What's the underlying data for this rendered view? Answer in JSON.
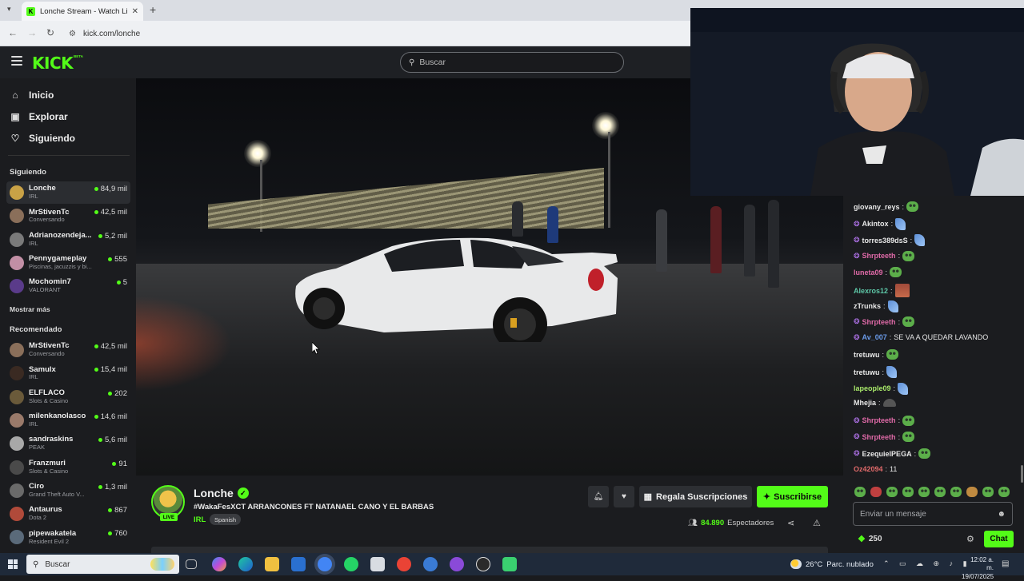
{
  "browser": {
    "tab_title": "Lonche Stream - Watch Live",
    "url": "kick.com/lonche"
  },
  "kick": {
    "logo": "KICK",
    "logo_badge": "BETA",
    "search_placeholder": "Buscar"
  },
  "sidebar": {
    "nav": [
      {
        "label": "Inicio",
        "icon": "home-icon"
      },
      {
        "label": "Explorar",
        "icon": "compass-icon"
      },
      {
        "label": "Siguiendo",
        "icon": "heart-icon"
      }
    ],
    "following_header": "Siguiendo",
    "following": [
      {
        "name": "Lonche",
        "category": "IRL",
        "viewers": "84,9 mil",
        "active": true,
        "avatar_color": "#c9a246"
      },
      {
        "name": "MrStivenTc",
        "category": "Conversando",
        "viewers": "42,5 mil",
        "avatar_color": "#8a6f5a"
      },
      {
        "name": "Adrianozendeja...",
        "category": "IRL",
        "viewers": "5,2 mil",
        "avatar_color": "#7a7a7a"
      },
      {
        "name": "Pennygameplay",
        "category": "Piscinas, jacuzzis y bi...",
        "viewers": "555",
        "avatar_color": "#c28fa5"
      },
      {
        "name": "Mochomin7",
        "category": "VALORANT",
        "viewers": "5",
        "avatar_color": "#5a3b8a"
      }
    ],
    "show_more": "Mostrar más",
    "recommended_header": "Recomendado",
    "recommended": [
      {
        "name": "MrStivenTc",
        "category": "Conversando",
        "viewers": "42,5 mil",
        "avatar_color": "#8a6f5a"
      },
      {
        "name": "Samulx",
        "category": "IRL",
        "viewers": "15,4 mil",
        "avatar_color": "#3a2a22"
      },
      {
        "name": "ELFLACO",
        "category": "Slots & Casino",
        "viewers": "202",
        "avatar_color": "#6a5a3a"
      },
      {
        "name": "milenkanolasco",
        "category": "IRL",
        "viewers": "14,6 mil",
        "avatar_color": "#9a7a6a"
      },
      {
        "name": "sandraskins",
        "category": "PEAK",
        "viewers": "5,6 mil",
        "avatar_color": "#a8a8a8"
      },
      {
        "name": "Franzmuri",
        "category": "Slots & Casino",
        "viewers": "91",
        "avatar_color": "#4a4a4a"
      },
      {
        "name": "Ciro",
        "category": "Grand Theft Auto V...",
        "viewers": "1,3 mil",
        "avatar_color": "#6a6a6a"
      },
      {
        "name": "Antaurus",
        "category": "Dota 2",
        "viewers": "867",
        "avatar_color": "#b04a3a"
      },
      {
        "name": "pipewakatela",
        "category": "Resident Evil 2",
        "viewers": "760",
        "avatar_color": "#5a6a7a"
      }
    ]
  },
  "stream": {
    "streamer": "Lonche",
    "live_badge": "LIVE",
    "title": "#WakaFesXCT ARRANCONES FT NATANAEL CANO Y EL BARBAS",
    "category": "IRL",
    "language": "Spanish",
    "gift_label": "Regala Suscripciones",
    "subscribe_label": "Suscribirse",
    "viewers_count": "84.890",
    "viewers_label": "Espectadores"
  },
  "chat": {
    "messages": [
      {
        "user": "giovany_reys",
        "color": "#e8e8e8",
        "badge": false,
        "emote": "frog"
      },
      {
        "user": "Akintox",
        "color": "#e8e8e8",
        "badge": true,
        "emote": "fish"
      },
      {
        "user": "torres389dsS",
        "color": "#e8e8e8",
        "badge": true,
        "emote": "fish"
      },
      {
        "user": "Shrpteeth",
        "color": "#e06aa8",
        "badge": true,
        "emote": "frog"
      },
      {
        "user": "luneta09",
        "color": "#e06aa8",
        "badge": false,
        "emote": "frog"
      },
      {
        "user": "Alexros12",
        "color": "#5ec8a8",
        "badge": false,
        "emote": "box"
      },
      {
        "user": "zTrunks",
        "color": "#e8e8e8",
        "badge": false,
        "emote": "fish"
      },
      {
        "user": "Shrpteeth",
        "color": "#e06aa8",
        "badge": true,
        "emote": "frog"
      },
      {
        "user": "Av_007",
        "color": "#6a9ae8",
        "badge": true,
        "text": "SE VA A QUEDAR LAVANDO"
      },
      {
        "user": "tretuwu",
        "color": "#e8e8e8",
        "badge": false,
        "emote": "frog"
      },
      {
        "user": "tretuwu",
        "color": "#e8e8e8",
        "badge": false,
        "emote": "fish"
      },
      {
        "user": "lapeople09",
        "color": "#a8e86a",
        "badge": false,
        "emote": "fish"
      },
      {
        "user": "Mhejia",
        "color": "#e8e8e8",
        "badge": false,
        "emote": "grey"
      },
      {
        "user": "Shrpteeth",
        "color": "#e06aa8",
        "badge": true,
        "emote": "frog"
      },
      {
        "user": "Shrpteeth",
        "color": "#e06aa8",
        "badge": true,
        "emote": "frog"
      },
      {
        "user": "EzequielPEGA",
        "color": "#e8e8e8",
        "badge": true,
        "emote": "frog"
      },
      {
        "user": "Oz42094",
        "color": "#e06a6a",
        "badge": false,
        "text": "11"
      }
    ],
    "input_placeholder": "Enviar un mensaje",
    "points": "250",
    "chat_button": "Chat"
  },
  "taskbar": {
    "search_label": "Buscar",
    "temperature": "26°C",
    "weather": "Parc. nublado",
    "time": "12:02 a. m.",
    "date": "19/07/2025"
  }
}
